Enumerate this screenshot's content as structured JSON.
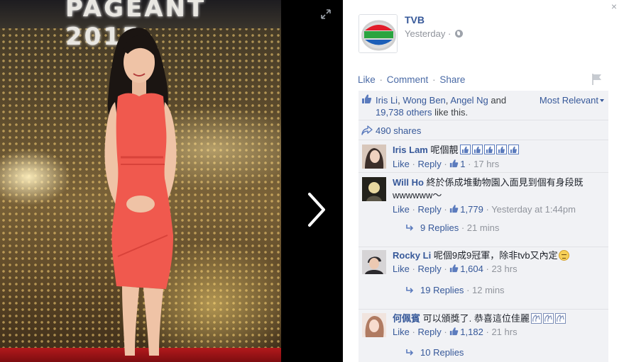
{
  "photo": {
    "backdrop_text": "PAGEANT 2015"
  },
  "post": {
    "page_name": "TVB",
    "timestamp": "Yesterday",
    "meta_separator": "·",
    "actions": {
      "like": "Like",
      "comment": "Comment",
      "share": "Share",
      "separator": "·"
    }
  },
  "likes": {
    "names": [
      "Iris Li",
      "Wong Ben",
      "Angel Ng"
    ],
    "sep_comma": ",",
    "and": "and",
    "others_link": "19,738 others",
    "suffix": "like this.",
    "sort_label": "Most Relevant"
  },
  "shares": {
    "label": "490 shares"
  },
  "comments": [
    {
      "name": "Iris Lam",
      "text": "呢個靚",
      "emoji": "like-icon x5",
      "like_label": "Like",
      "reply_label": "Reply",
      "like_count": "1",
      "time": "17 hrs",
      "avatar_color": "#3b2e2a"
    },
    {
      "name": "Will Ho",
      "text": "終於係成堆動物園入面見到個有身段既wwwwww～",
      "like_label": "Like",
      "reply_label": "Reply",
      "like_count": "1,779",
      "time": "Yesterday at 1:44pm",
      "replies_label": "9 Replies",
      "replies_time": "21 mins",
      "avatar_color": "#23221c"
    },
    {
      "name": "Rocky Li",
      "text": "呢個9成9冠軍，除非tvb又內定",
      "emoji": "unamused-face-icon",
      "like_label": "Like",
      "reply_label": "Reply",
      "like_count": "1,604",
      "time": "23 hrs",
      "replies_label": "19 Replies",
      "replies_time": "12 mins",
      "avatar_color": "#2c2a2e"
    },
    {
      "name": "何佩賓",
      "text": "可以頒獎了. 恭喜這位佳麗",
      "emoji": "clapping-hands-icon x3",
      "like_label": "Like",
      "reply_label": "Reply",
      "like_count": "1,182",
      "time": "21 hrs",
      "replies_label": "10 Replies",
      "avatar_color": "#d9b7a8"
    }
  ],
  "ui": {
    "close_glyph": "×",
    "meta_separator": "·"
  },
  "colors": {
    "link": "#365899",
    "meta": "#90949c",
    "ufi_bg": "#f1f2f5",
    "dress": "#f0594e"
  }
}
